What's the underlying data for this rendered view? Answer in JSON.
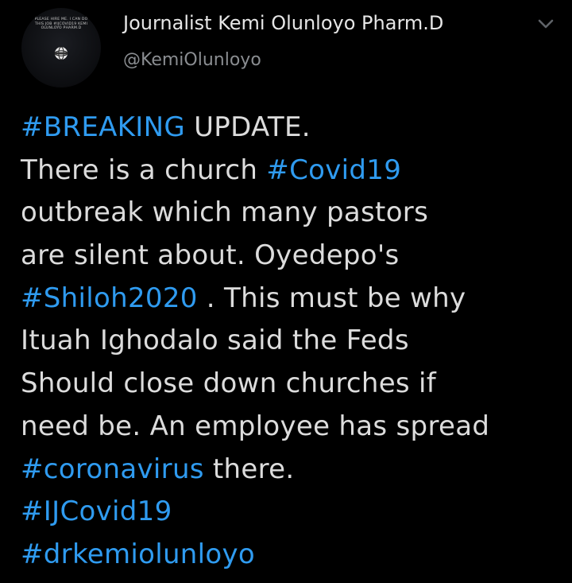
{
  "author": {
    "display_name": "Journalist Kemi Olunloyo Pharm.D",
    "handle": "@KemiOlunloyo",
    "avatar_text_lines": [
      "PLEASE HIRE ME. I CAN DO",
      "THIS JOB #IJCOVID19 KEMI",
      "OLUNLOYO PHARM.D"
    ]
  },
  "colors": {
    "background": "#000000",
    "text": "#dcdcdc",
    "handle": "#8a8d91",
    "hashtag": "#2f9bf0"
  },
  "icons": {
    "menu": "chevron-down-icon",
    "avatar_logo": "globe-logo-icon"
  },
  "tweet": {
    "l1_tag": "#BREAKING",
    "l1_text": " UPDATE.",
    "l2_text": "There is a church ",
    "l2_tag": "#Covid19",
    "l3_text": "outbreak which many pastors",
    "l4_text": "are silent about. Oyedepo's",
    "l5_tag": "#Shiloh2020",
    "l5_text": " . This must be why",
    "l6_text": "Ituah Ighodalo said the Feds",
    "l7_text": "Should close down churches if",
    "l8_text": "need be. An employee has spread",
    "l9_tag": "#coronavirus",
    "l9_text": " there.",
    "l10_tag": "#IJCovid19",
    "l11_tag": "#drkemiolunloyo"
  }
}
